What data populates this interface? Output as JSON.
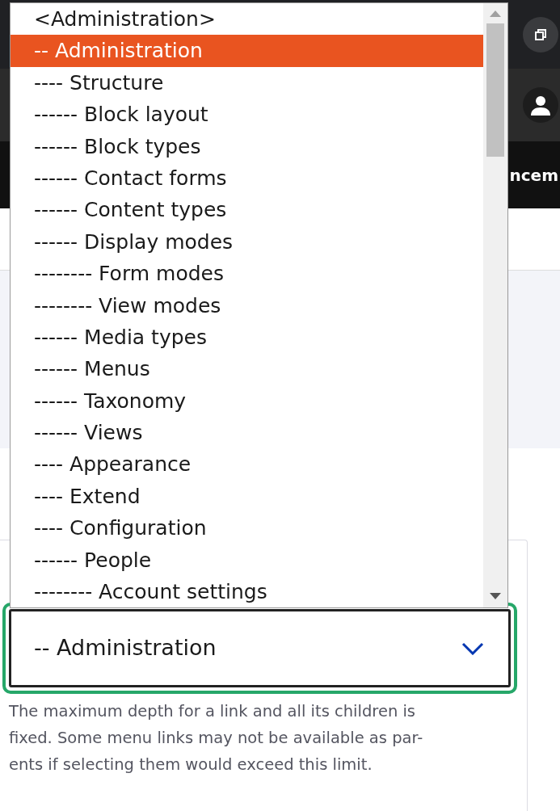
{
  "background": {
    "header_fragment": "ncem"
  },
  "parent_select": {
    "value": "-- Administration",
    "options": [
      {
        "label": "<Administration>",
        "selected": false
      },
      {
        "label": "-- Administration",
        "selected": true
      },
      {
        "label": "---- Structure",
        "selected": false
      },
      {
        "label": "------ Block layout",
        "selected": false
      },
      {
        "label": "------ Block types",
        "selected": false
      },
      {
        "label": "------ Contact forms",
        "selected": false
      },
      {
        "label": "------ Content types",
        "selected": false
      },
      {
        "label": "------ Display modes",
        "selected": false
      },
      {
        "label": "-------- Form modes",
        "selected": false
      },
      {
        "label": "-------- View modes",
        "selected": false
      },
      {
        "label": "------ Media types",
        "selected": false
      },
      {
        "label": "------ Menus",
        "selected": false
      },
      {
        "label": "------ Taxonomy",
        "selected": false
      },
      {
        "label": "------ Views",
        "selected": false
      },
      {
        "label": "---- Appearance",
        "selected": false
      },
      {
        "label": "---- Extend",
        "selected": false
      },
      {
        "label": "---- Configuration",
        "selected": false
      },
      {
        "label": "------ People",
        "selected": false
      },
      {
        "label": "-------- Account settings",
        "selected": false
      }
    ]
  },
  "help_lines": [
    "The maximum depth for a link and all its children is",
    "fixed. Some menu links may not be available as par-",
    "ents if selecting them would exceed this limit."
  ]
}
